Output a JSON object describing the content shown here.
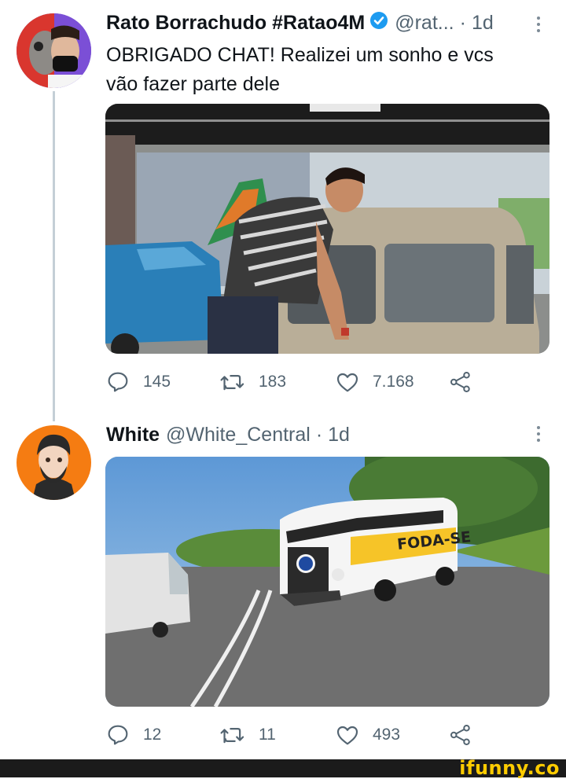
{
  "tweets": [
    {
      "author_name": "Rato Borrachudo #Ratao4M",
      "handle": "@rat...",
      "separator": "·",
      "time": "1d",
      "verified": true,
      "text_lines": [
        "OBRIGADO CHAT! Realizei um sonho e vcs",
        "vão fazer parte dele"
      ],
      "stats": {
        "replies": "145",
        "retweets": "183",
        "likes": "7.168"
      }
    },
    {
      "author_name": "White",
      "handle": "@White_Central",
      "separator": "·",
      "time": "1d",
      "verified": false,
      "media_text": "FODA-SE",
      "stats": {
        "replies": "12",
        "retweets": "11",
        "likes": "493"
      }
    }
  ],
  "footer": {
    "watermark": "ifunny.co"
  },
  "colors": {
    "text": "#0f1419",
    "muted": "#536471",
    "verified": "#1d9bf0",
    "thread_line": "#c4cfd6",
    "footer_bg": "#1b1b1b",
    "watermark": "#ffcc00"
  }
}
